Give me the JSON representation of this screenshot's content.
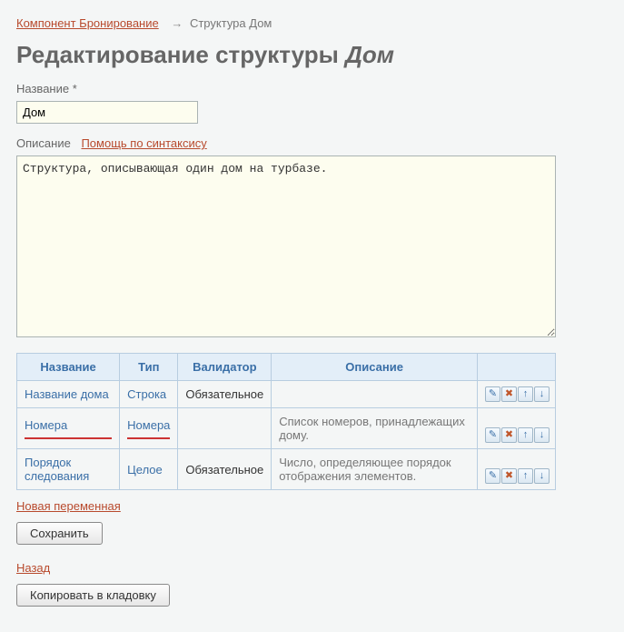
{
  "breadcrumb": {
    "root": "Компонент Бронирование",
    "current": "Структура Дом"
  },
  "heading": {
    "prefix": "Редактирование структуры ",
    "entity": "Дом"
  },
  "name_field": {
    "label": "Название *",
    "value": "Дом"
  },
  "desc_field": {
    "label": "Описание",
    "help_link": "Помощь по синтаксису",
    "value": "Структура, описывающая один дом на турбазе."
  },
  "table": {
    "headers": {
      "name": "Название",
      "type": "Тип",
      "validator": "Валидатор",
      "desc": "Описание"
    },
    "rows": [
      {
        "name": "Название дома",
        "type": "Строка",
        "validator": "Обязательное",
        "desc": "",
        "underline": false
      },
      {
        "name": "Номера",
        "type": "Номера",
        "validator": "",
        "desc": "Список номеров, принадлежащих дому.",
        "underline": true
      },
      {
        "name": "Порядок следования",
        "type": "Целое",
        "validator": "Обязательное",
        "desc": "Число, определяющее порядок отображения элементов.",
        "underline": false
      }
    ]
  },
  "icons": {
    "edit": "✎",
    "delete": "✖",
    "up": "↑",
    "down": "↓"
  },
  "links": {
    "new_var": "Новая переменная",
    "back": "Назад"
  },
  "buttons": {
    "save": "Сохранить",
    "copy": "Копировать в кладовку"
  }
}
